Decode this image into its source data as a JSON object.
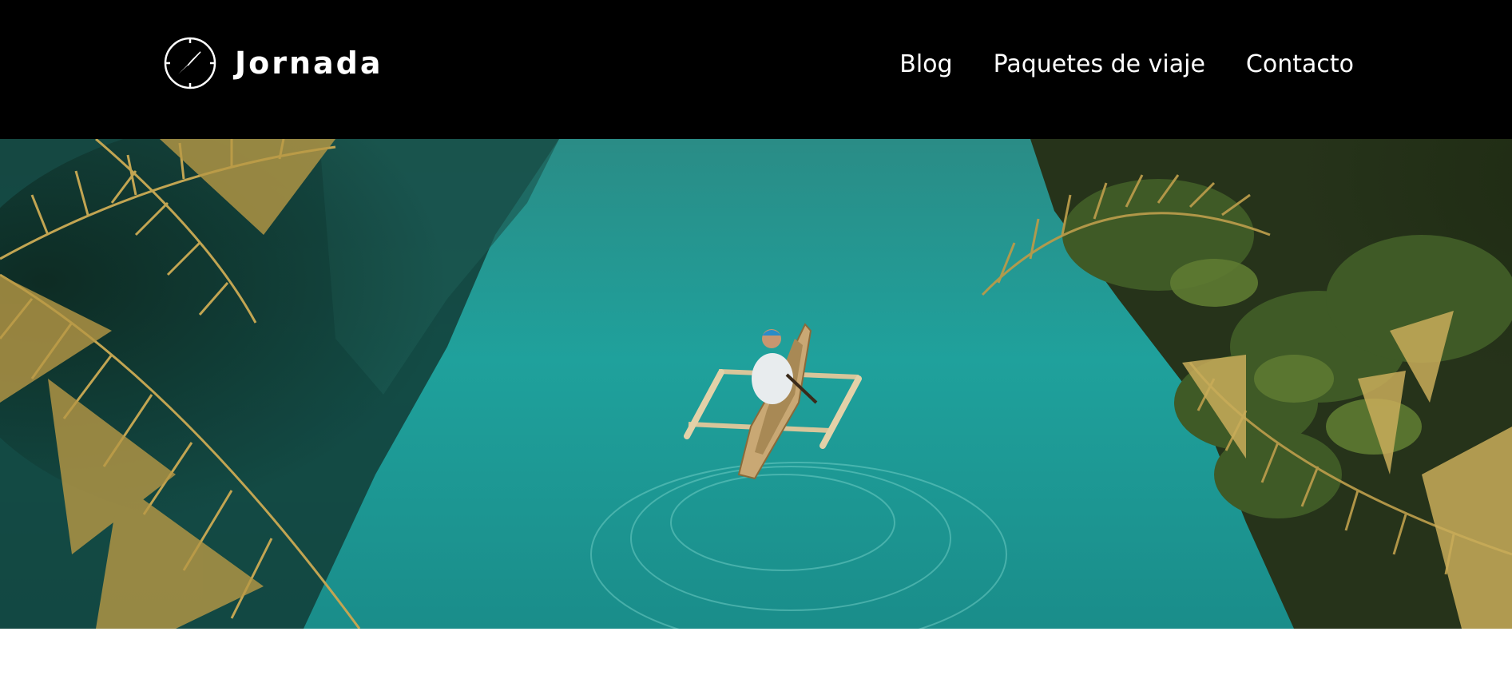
{
  "brand": {
    "name": "Jornada",
    "icon": "compass-icon"
  },
  "nav": {
    "items": [
      {
        "label": "Blog"
      },
      {
        "label": "Paquetes de viaje"
      },
      {
        "label": "Contacto"
      }
    ]
  },
  "hero": {
    "image": "river-canoe-photo"
  },
  "colors": {
    "header_bg": "#000000",
    "header_text": "#ffffff",
    "water": "#1f9e9a",
    "foliage": "#2c3a1a",
    "palm": "#b59a48",
    "page_bg": "#ffffff"
  }
}
